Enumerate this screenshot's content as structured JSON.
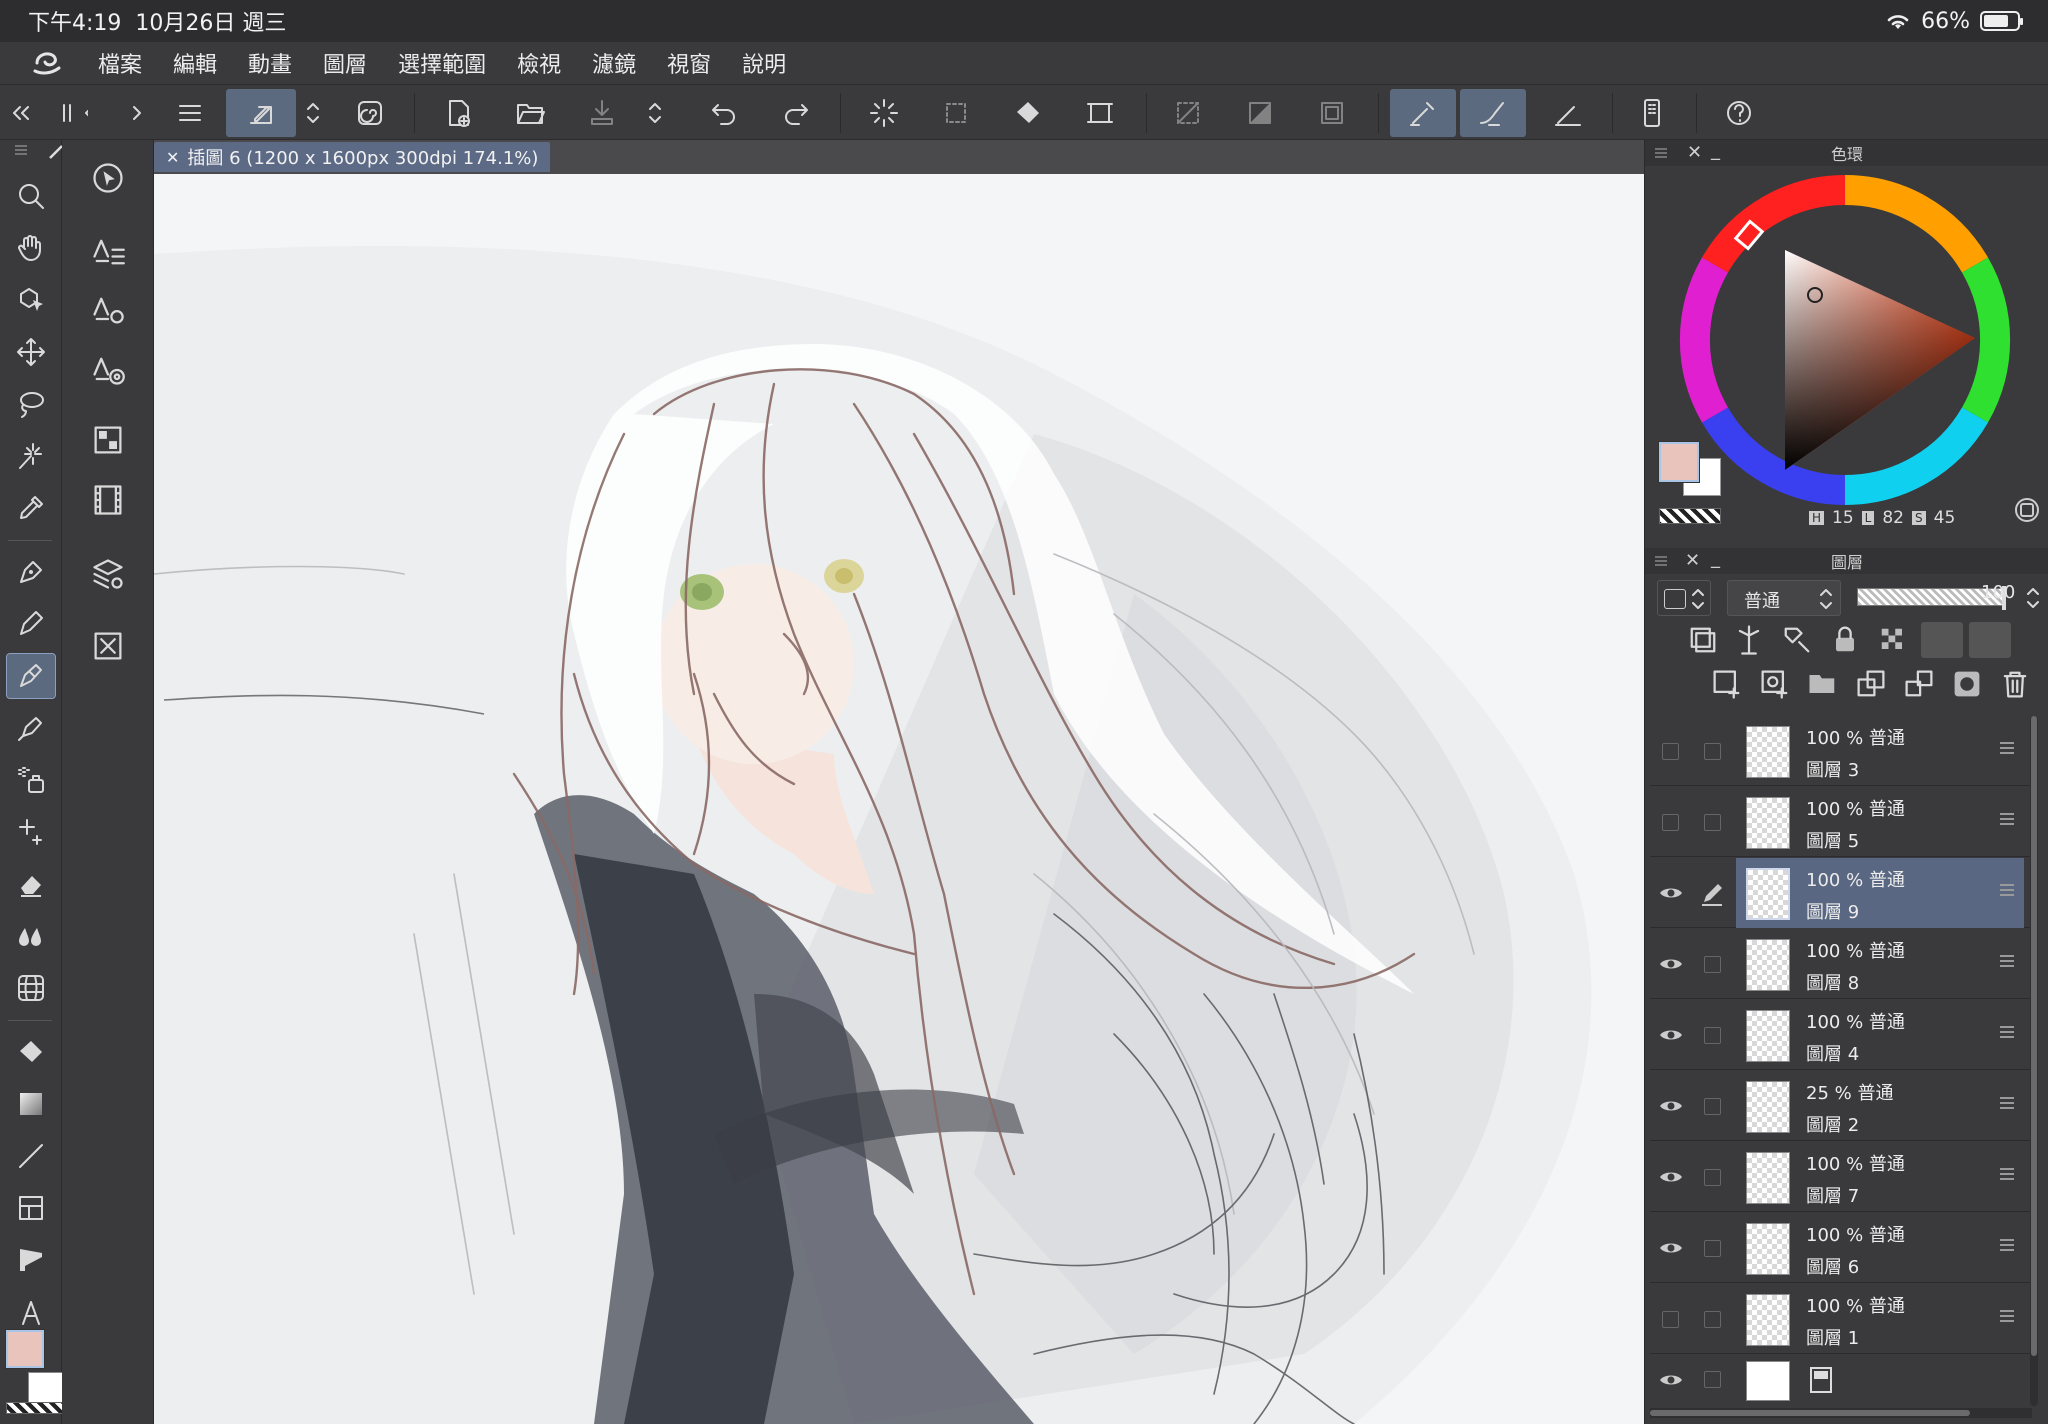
{
  "status": {
    "time": "下午4:19",
    "date": "10月26日 週三",
    "battery": "66%"
  },
  "menu": [
    "檔案",
    "編輯",
    "動畫",
    "圖層",
    "選擇範圍",
    "檢視",
    "濾鏡",
    "視窗",
    "說明"
  ],
  "document_tab": {
    "title": "插圖 6 (1200 x 1600px 300dpi 174.1%)"
  },
  "color_wheel": {
    "title": "色環",
    "h_label": "H",
    "h": "15",
    "l_label": "L",
    "l": "82",
    "s_label": "S",
    "s": "45",
    "main_color": "#e8c4bc",
    "sub_color": "#ffffff"
  },
  "layers_panel": {
    "title": "圖層",
    "blend_mode": "普通",
    "opacity": "100"
  },
  "layers": [
    {
      "opacity_mode": "100 % 普通",
      "name": "圖層 3",
      "visible": false,
      "selected": false
    },
    {
      "opacity_mode": "100 % 普通",
      "name": "圖層 5",
      "visible": false,
      "selected": false
    },
    {
      "opacity_mode": "100 % 普通",
      "name": "圖層 9",
      "visible": true,
      "selected": true
    },
    {
      "opacity_mode": "100 % 普通",
      "name": "圖層 8",
      "visible": true,
      "selected": false
    },
    {
      "opacity_mode": "100 % 普通",
      "name": "圖層 4",
      "visible": true,
      "selected": false
    },
    {
      "opacity_mode": "25 % 普通",
      "name": "圖層 2",
      "visible": true,
      "selected": false
    },
    {
      "opacity_mode": "100 % 普通",
      "name": "圖層 7",
      "visible": true,
      "selected": false
    },
    {
      "opacity_mode": "100 % 普通",
      "name": "圖層 6",
      "visible": true,
      "selected": false
    },
    {
      "opacity_mode": "100 % 普通",
      "name": "圖層 1",
      "visible": false,
      "selected": false
    }
  ],
  "colors": {
    "accent": "#5c6a80",
    "panel": "#3a3a3c"
  }
}
